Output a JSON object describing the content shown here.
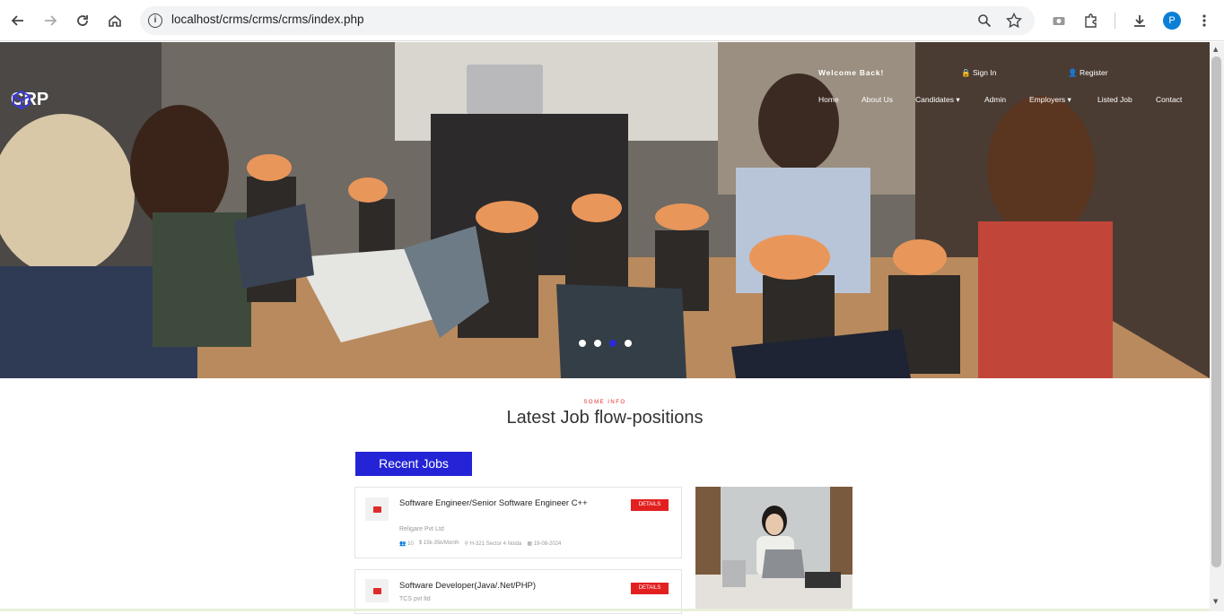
{
  "browser": {
    "url": "localhost/crms/crms/crms/index.php",
    "profile_initial": "P"
  },
  "hero": {
    "logo": "CRP",
    "welcome": "Welcome Back!",
    "sign_in": "Sign In",
    "register": "Register",
    "menu": [
      "Home",
      "About Us",
      "Candidates",
      "Admin",
      "Employers",
      "Listed Job",
      "Contact"
    ],
    "dropdown_items": [
      "Candidates",
      "Employers"
    ],
    "slides": 4,
    "active_slide": 3
  },
  "section": {
    "kicker": "SOME INFO",
    "title": "Latest Job flow-positions",
    "tab": "Recent Jobs"
  },
  "jobs": [
    {
      "title": "Software Engineer/Senior Software Engineer C++",
      "company": "Religare Pvt Ltd",
      "openings": "10",
      "salary": "15k-35k/Month",
      "location": "H-321 Sector 4 Noida",
      "date": "19-08-2024",
      "button": "DETAILS"
    },
    {
      "title": "Software Developer(Java/.Net/PHP)",
      "company": "TCS pvt ltd",
      "button": "DETAILS"
    }
  ],
  "colors": {
    "accent": "#2424d6",
    "danger": "#e32020"
  }
}
